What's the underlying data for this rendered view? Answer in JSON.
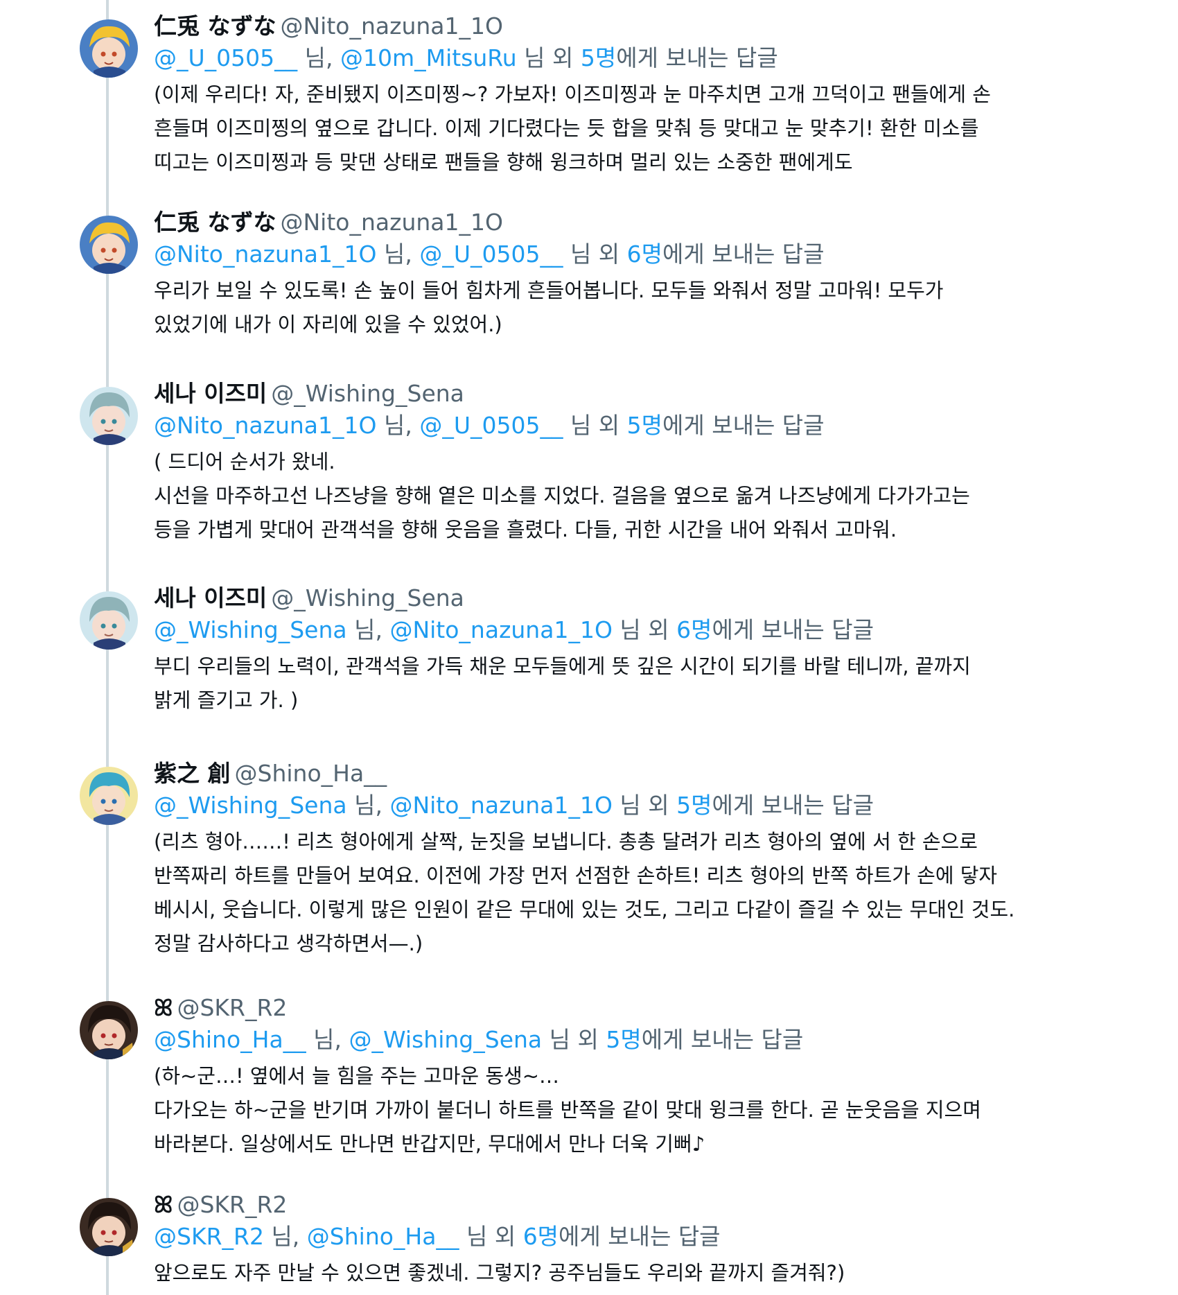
{
  "replying_suffix": "에게 보내는 답글",
  "nim": " 님,",
  "nim_end": " 님",
  "oe": " 외 ",
  "tweets": [
    {
      "display_name": "仁兎 なずな",
      "handle": "@Nito_nazuna1_1O",
      "mention1": "@_U_0505__",
      "mention2": "@10m_MitsuRu",
      "others": "5명",
      "body": [
        "(이제 우리다! 자, 준비됐지 이즈미찡~? 가보자! 이즈미찡과 눈 마주치면 고개 끄덕이고 팬들에게 손",
        "흔들며 이즈미찡의 옆으로 갑니다. 이제 기다렸다는 듯 합을 맞춰 등 맞대고 눈 맞추기! 환한 미소를",
        "띠고는 이즈미찡과 등 맞댄 상태로 팬들을 향해 윙크하며 멀리 있는 소중한 팬에게도"
      ]
    },
    {
      "display_name": "仁兎 なずな",
      "handle": "@Nito_nazuna1_1O",
      "mention1": "@Nito_nazuna1_1O",
      "mention2": "@_U_0505__",
      "others": "6명",
      "body": [
        "우리가 보일 수 있도록! 손 높이 들어 힘차게 흔들어봅니다. 모두들 와줘서 정말 고마워! 모두가",
        "있었기에 내가 이 자리에 있을 수 있었어.)"
      ]
    },
    {
      "display_name": "세나 이즈미",
      "handle": "@_Wishing_Sena",
      "mention1": "@Nito_nazuna1_1O",
      "mention2": "@_U_0505__",
      "others": "5명",
      "body": [
        "( 드디어 순서가 왔네.",
        " 시선을 마주하고선 나즈냥을 향해 옅은 미소를 지었다. 걸음을 옆으로 옮겨 나즈냥에게 다가가고는",
        "등을 가볍게 맞대어 관객석을 향해 웃음을 흘렸다. 다들, 귀한 시간을 내어 와줘서 고마워."
      ]
    },
    {
      "display_name": "세나 이즈미",
      "handle": "@_Wishing_Sena",
      "mention1": "@_Wishing_Sena",
      "mention2": "@Nito_nazuna1_1O",
      "others": "6명",
      "body": [
        "부디 우리들의 노력이, 관객석을 가득 채운 모두들에게 뜻 깊은 시간이 되기를 바랄 테니까, 끝까지",
        "밝게 즐기고 가. )"
      ]
    },
    {
      "display_name": "紫之 創",
      "handle": "@Shino_Ha__",
      "mention1": "@_Wishing_Sena",
      "mention2": "@Nito_nazuna1_1O",
      "others": "5명",
      "body": [
        "(리츠 형아……! 리츠 형아에게 살짝, 눈짓을 보냅니다. 총총 달려가 리츠 형아의 옆에 서 한 손으로",
        "반쪽짜리 하트를 만들어 보여요. 이전에 가장 먼저 선점한 손하트! 리츠 형아의 반쪽 하트가 손에 닿자",
        "베시시, 웃습니다. 이렇게 많은 인원이 같은 무대에 있는 것도, 그리고 다같이 즐길 수 있는 무대인 것도.",
        "정말 감사하다고 생각하면서—.)"
      ]
    },
    {
      "display_name": "ꕤ",
      "handle": "@SKR_R2",
      "mention1": "@Shino_Ha__",
      "mention2": "@_Wishing_Sena",
      "others": "5명",
      "body": [
        "(하~군…! 옆에서 늘 힘을 주는 고마운 동생~…",
        "다가오는 하~군을 반기며 가까이 붙더니 하트를 반쪽을 같이 맞대 윙크를 한다. 곧 눈웃음을 지으며",
        "바라본다. 일상에서도 만나면 반갑지만, 무대에서 만나 더욱 기뻐♪"
      ]
    },
    {
      "display_name": "ꕤ",
      "handle": "@SKR_R2",
      "mention1": "@SKR_R2",
      "mention2": "@Shino_Ha__",
      "others": "6명",
      "body": [
        "앞으로도 자주 만날 수 있으면 좋겠네. 그렇지? 공주님들도 우리와 끝까지 즐겨줘?)"
      ]
    }
  ]
}
